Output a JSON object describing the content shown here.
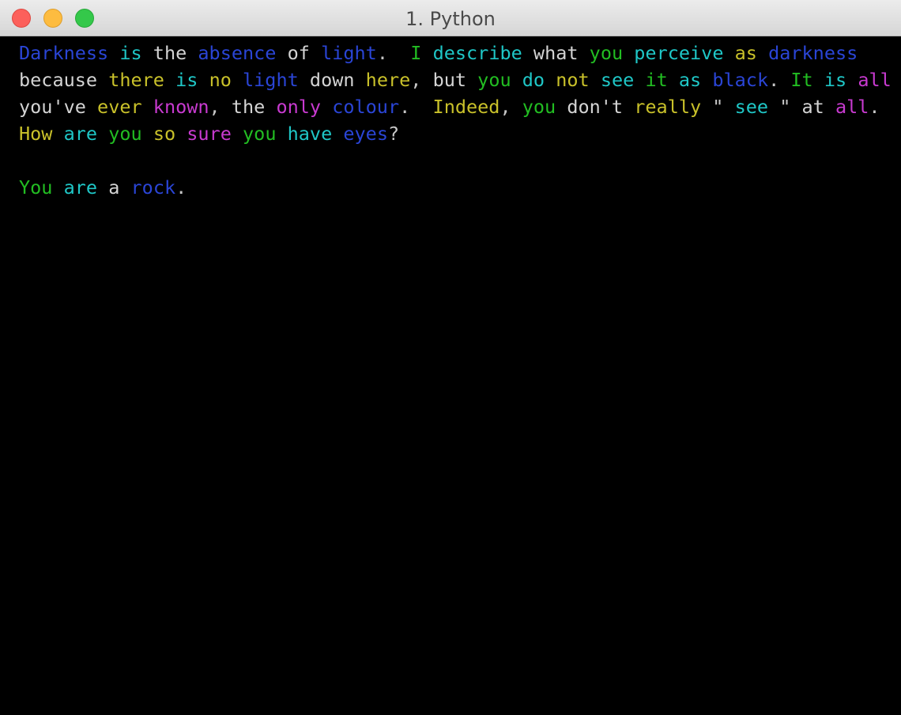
{
  "window": {
    "title": "1. Python"
  },
  "colors": {
    "background": "#000000",
    "default_text": "#c7c7c7",
    "blue": "#2a45d6",
    "cyan": "#1fc7c7",
    "green": "#22bd22",
    "yellow": "#c9c12a",
    "magenta": "#c83ad0",
    "white": "#d4d4d4"
  },
  "terminal": {
    "lines": [
      [
        {
          "t": "Darkness",
          "c": "blue"
        },
        {
          "t": " "
        },
        {
          "t": "is",
          "c": "cyan"
        },
        {
          "t": " "
        },
        {
          "t": "the",
          "c": "white"
        },
        {
          "t": " "
        },
        {
          "t": "absence",
          "c": "blue"
        },
        {
          "t": " "
        },
        {
          "t": "of",
          "c": "white"
        },
        {
          "t": " "
        },
        {
          "t": "light",
          "c": "blue"
        },
        {
          "t": ".  "
        },
        {
          "t": "I",
          "c": "green"
        },
        {
          "t": " "
        },
        {
          "t": "describe",
          "c": "cyan"
        },
        {
          "t": " "
        },
        {
          "t": "what",
          "c": "white"
        },
        {
          "t": " "
        },
        {
          "t": "you",
          "c": "green"
        },
        {
          "t": " "
        },
        {
          "t": "perceive",
          "c": "cyan"
        },
        {
          "t": " "
        },
        {
          "t": "as",
          "c": "yellow"
        },
        {
          "t": " "
        },
        {
          "t": "darkness",
          "c": "blue"
        }
      ],
      [
        {
          "t": "because",
          "c": "white"
        },
        {
          "t": " "
        },
        {
          "t": "there",
          "c": "yellow"
        },
        {
          "t": " "
        },
        {
          "t": "is",
          "c": "cyan"
        },
        {
          "t": " "
        },
        {
          "t": "no",
          "c": "yellow"
        },
        {
          "t": " "
        },
        {
          "t": "light",
          "c": "blue"
        },
        {
          "t": " "
        },
        {
          "t": "down",
          "c": "white"
        },
        {
          "t": " "
        },
        {
          "t": "here",
          "c": "yellow"
        },
        {
          "t": ", "
        },
        {
          "t": "but",
          "c": "white"
        },
        {
          "t": " "
        },
        {
          "t": "you",
          "c": "green"
        },
        {
          "t": " "
        },
        {
          "t": "do",
          "c": "cyan"
        },
        {
          "t": " "
        },
        {
          "t": "not",
          "c": "yellow"
        },
        {
          "t": " "
        },
        {
          "t": "see",
          "c": "cyan"
        },
        {
          "t": " "
        },
        {
          "t": "it",
          "c": "green"
        },
        {
          "t": " "
        },
        {
          "t": "as",
          "c": "cyan"
        },
        {
          "t": " "
        },
        {
          "t": "black",
          "c": "blue"
        },
        {
          "t": ". "
        },
        {
          "t": "It",
          "c": "green"
        },
        {
          "t": " "
        },
        {
          "t": "is",
          "c": "cyan"
        },
        {
          "t": " "
        },
        {
          "t": "all",
          "c": "magenta"
        }
      ],
      [
        {
          "t": "you've",
          "c": "white"
        },
        {
          "t": " "
        },
        {
          "t": "ever",
          "c": "yellow"
        },
        {
          "t": " "
        },
        {
          "t": "known",
          "c": "magenta"
        },
        {
          "t": ", "
        },
        {
          "t": "the",
          "c": "white"
        },
        {
          "t": " "
        },
        {
          "t": "only",
          "c": "magenta"
        },
        {
          "t": " "
        },
        {
          "t": "colour",
          "c": "blue"
        },
        {
          "t": ".  "
        },
        {
          "t": "Indeed",
          "c": "yellow"
        },
        {
          "t": ", "
        },
        {
          "t": "you",
          "c": "green"
        },
        {
          "t": " "
        },
        {
          "t": "don't",
          "c": "white"
        },
        {
          "t": " "
        },
        {
          "t": "really",
          "c": "yellow"
        },
        {
          "t": " \" "
        },
        {
          "t": "see",
          "c": "cyan"
        },
        {
          "t": " \" "
        },
        {
          "t": "at",
          "c": "white"
        },
        {
          "t": " "
        },
        {
          "t": "all",
          "c": "magenta"
        },
        {
          "t": "."
        }
      ],
      [
        {
          "t": "How",
          "c": "yellow"
        },
        {
          "t": " "
        },
        {
          "t": "are",
          "c": "cyan"
        },
        {
          "t": " "
        },
        {
          "t": "you",
          "c": "green"
        },
        {
          "t": " "
        },
        {
          "t": "so",
          "c": "yellow"
        },
        {
          "t": " "
        },
        {
          "t": "sure",
          "c": "magenta"
        },
        {
          "t": " "
        },
        {
          "t": "you",
          "c": "green"
        },
        {
          "t": " "
        },
        {
          "t": "have",
          "c": "cyan"
        },
        {
          "t": " "
        },
        {
          "t": "eyes",
          "c": "blue"
        },
        {
          "t": "?"
        }
      ],
      [],
      [
        {
          "t": "You",
          "c": "green"
        },
        {
          "t": " "
        },
        {
          "t": "are",
          "c": "cyan"
        },
        {
          "t": " "
        },
        {
          "t": "a",
          "c": "white"
        },
        {
          "t": " "
        },
        {
          "t": "rock",
          "c": "blue"
        },
        {
          "t": "."
        }
      ]
    ]
  }
}
